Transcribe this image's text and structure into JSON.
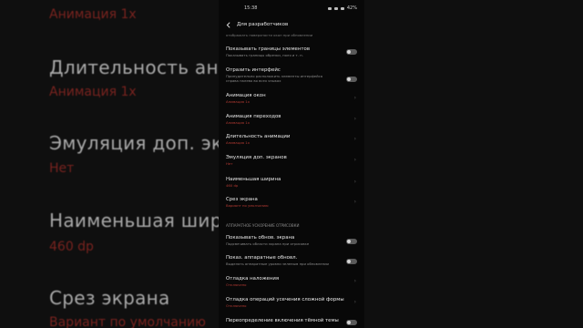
{
  "background": {
    "items": [
      {
        "title": "",
        "value": "Анимация 1x"
      },
      {
        "title": "Длительность анимации",
        "value": "Анимация 1x"
      },
      {
        "title": "Эмуляция доп. экранов",
        "value": "Нет"
      },
      {
        "title": "Наименьшая ширина",
        "value": "460 dp"
      },
      {
        "title": "Срез экрана",
        "value": "Вариант по умолчанию"
      }
    ]
  },
  "status_bar": {
    "time": "15:38",
    "battery": "42%"
  },
  "app_bar": {
    "title": "Для разработчиков"
  },
  "top_partial": "отображать поверхности окон при обновлении",
  "items": [
    {
      "title": "Показывать границы элементов",
      "desc": "Показывать границы обрезки, поля и т. п.",
      "value": "",
      "control": "toggle"
    },
    {
      "title": "Отразить интерфейс",
      "desc": "Принудительно расположить элементы интерфейса справа налево во всех языках",
      "value": "",
      "control": "toggle"
    },
    {
      "title": "Анимация окон",
      "desc": "",
      "value": "Анимация 1x",
      "control": "chevron"
    },
    {
      "title": "Анимация переходов",
      "desc": "",
      "value": "Анимация 1x",
      "control": "chevron"
    },
    {
      "title": "Длительность анимации",
      "desc": "",
      "value": "Анимация 1x",
      "control": "chevron"
    },
    {
      "title": "Эмуляция доп. экранов",
      "desc": "",
      "value": "Нет",
      "control": "chevron"
    },
    {
      "title": "Наименьшая ширина",
      "desc": "",
      "value": "460 dp",
      "control": "chevron"
    },
    {
      "title": "Срез экрана",
      "desc": "",
      "value": "Вариант по умолчанию",
      "control": "chevron"
    }
  ],
  "section_header": "АППАРАТНОЕ УСКОРЕНИЕ ОТРИСОВКИ",
  "items2": [
    {
      "title": "Показывать обнов. экрана",
      "desc": "Подсвечивать области экрана при отрисовке",
      "value": "",
      "control": "toggle"
    },
    {
      "title": "Показ. аппаратные обновл.",
      "desc": "Выделять аппаратные уровни зеленым при обновлении",
      "value": "",
      "control": "toggle"
    },
    {
      "title": "Отладка наложения",
      "desc": "",
      "value": "Отключено",
      "control": "chevron"
    },
    {
      "title": "Отладка операций усечения сложной формы",
      "desc": "",
      "value": "Отключено",
      "control": "chevron"
    },
    {
      "title": "Переопределение включения тёмной темы",
      "desc": "",
      "value": "",
      "control": "toggle"
    }
  ],
  "colors": {
    "accent_red": "#b23a33",
    "background": "#080808"
  }
}
